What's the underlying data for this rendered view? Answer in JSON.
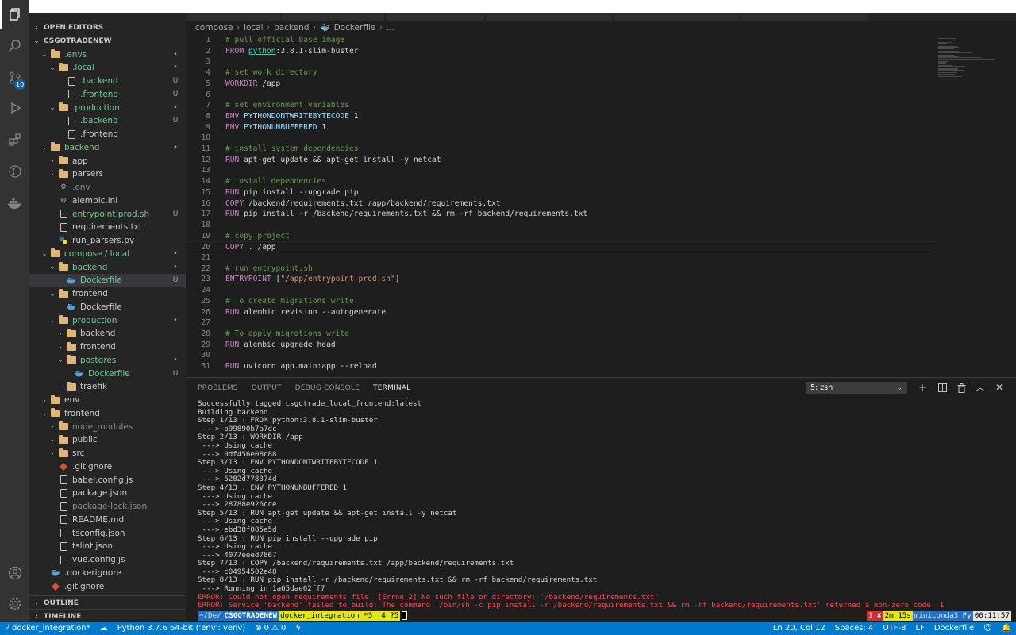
{
  "activity": {
    "scm_badge": "10"
  },
  "sidebar": {
    "open_editors": "OPEN EDITORS",
    "root": "CSGOTRADENEW",
    "tree": [
      {
        "label": ".envs",
        "depth": 1,
        "type": "folder",
        "open": true,
        "color": "green",
        "mark": "•"
      },
      {
        "label": ".local",
        "depth": 2,
        "type": "folder",
        "open": true,
        "color": "green",
        "mark": "•"
      },
      {
        "label": ".backend",
        "depth": 3,
        "type": "file",
        "color": "green",
        "mark": "U"
      },
      {
        "label": ".frontend",
        "depth": 3,
        "type": "file",
        "color": "green",
        "mark": "U"
      },
      {
        "label": ".production",
        "depth": 2,
        "type": "folder",
        "open": true,
        "color": "green",
        "mark": "•"
      },
      {
        "label": ".backend",
        "depth": 3,
        "type": "file",
        "color": "green",
        "mark": "U"
      },
      {
        "label": ".frontend",
        "depth": 3,
        "type": "file",
        "color": "normal",
        "mark": ""
      },
      {
        "label": "backend",
        "depth": 1,
        "type": "folder",
        "open": true,
        "color": "green",
        "mark": "•"
      },
      {
        "label": "app",
        "depth": 2,
        "type": "folder",
        "open": false,
        "color": "normal",
        "mark": ""
      },
      {
        "label": "parsers",
        "depth": 2,
        "type": "folder",
        "open": false,
        "color": "normal",
        "mark": ""
      },
      {
        "label": ".env",
        "depth": 2,
        "type": "gear",
        "color": "dim",
        "mark": ""
      },
      {
        "label": "alembic.ini",
        "depth": 2,
        "type": "gear",
        "color": "normal",
        "mark": ""
      },
      {
        "label": "entrypoint.prod.sh",
        "depth": 2,
        "type": "file",
        "color": "green",
        "mark": "U"
      },
      {
        "label": "requirements.txt",
        "depth": 2,
        "type": "file",
        "color": "normal",
        "mark": ""
      },
      {
        "label": "run_parsers.py",
        "depth": 2,
        "type": "python",
        "color": "normal",
        "mark": ""
      },
      {
        "label": "compose / local",
        "depth": 1,
        "type": "folder",
        "open": true,
        "color": "green",
        "mark": "•"
      },
      {
        "label": "backend",
        "depth": 2,
        "type": "folder",
        "open": true,
        "color": "green",
        "mark": "•"
      },
      {
        "label": "Dockerfile",
        "depth": 3,
        "type": "docker",
        "color": "green",
        "mark": "U",
        "selected": true
      },
      {
        "label": "frontend",
        "depth": 2,
        "type": "folder",
        "open": true,
        "color": "normal",
        "mark": ""
      },
      {
        "label": "Dockerfile",
        "depth": 3,
        "type": "docker",
        "color": "normal",
        "mark": ""
      },
      {
        "label": "production",
        "depth": 2,
        "type": "folder",
        "open": true,
        "color": "green",
        "mark": "•"
      },
      {
        "label": "backend",
        "depth": 3,
        "type": "folder",
        "open": false,
        "color": "normal",
        "mark": ""
      },
      {
        "label": "frontend",
        "depth": 3,
        "type": "folder",
        "open": false,
        "color": "normal",
        "mark": ""
      },
      {
        "label": "postgres",
        "depth": 3,
        "type": "folder",
        "open": true,
        "color": "green",
        "mark": "•"
      },
      {
        "label": "Dockerfile",
        "depth": 4,
        "type": "docker",
        "color": "green",
        "mark": "U"
      },
      {
        "label": "traefik",
        "depth": 3,
        "type": "folder",
        "open": false,
        "color": "normal",
        "mark": ""
      },
      {
        "label": "env",
        "depth": 1,
        "type": "folder",
        "open": false,
        "color": "normal",
        "mark": ""
      },
      {
        "label": "frontend",
        "depth": 1,
        "type": "folder",
        "open": true,
        "color": "normal",
        "mark": ""
      },
      {
        "label": "node_modules",
        "depth": 2,
        "type": "folder",
        "open": false,
        "color": "dim",
        "mark": ""
      },
      {
        "label": "public",
        "depth": 2,
        "type": "folder",
        "open": false,
        "color": "normal",
        "mark": ""
      },
      {
        "label": "src",
        "depth": 2,
        "type": "folder",
        "open": false,
        "color": "normal",
        "mark": ""
      },
      {
        "label": ".gitignore",
        "depth": 2,
        "type": "git",
        "color": "normal",
        "mark": ""
      },
      {
        "label": "babel.config.js",
        "depth": 2,
        "type": "file",
        "color": "normal",
        "mark": ""
      },
      {
        "label": "package.json",
        "depth": 2,
        "type": "file",
        "color": "normal",
        "mark": ""
      },
      {
        "label": "package-lock.json",
        "depth": 2,
        "type": "file",
        "color": "dim",
        "mark": ""
      },
      {
        "label": "README.md",
        "depth": 2,
        "type": "file",
        "color": "normal",
        "mark": ""
      },
      {
        "label": "tsconfig.json",
        "depth": 2,
        "type": "file",
        "color": "normal",
        "mark": ""
      },
      {
        "label": "tslint.json",
        "depth": 2,
        "type": "file",
        "color": "normal",
        "mark": ""
      },
      {
        "label": "vue.config.js",
        "depth": 2,
        "type": "file",
        "color": "normal",
        "mark": ""
      },
      {
        "label": ".dockerignore",
        "depth": 1,
        "type": "docker",
        "color": "normal",
        "mark": ""
      },
      {
        "label": ".gitignore",
        "depth": 1,
        "type": "git",
        "color": "normal",
        "mark": ""
      }
    ],
    "outline": "OUTLINE",
    "timeline": "TIMELINE"
  },
  "breadcrumb": [
    "compose",
    "local",
    "backend",
    "Dockerfile",
    "..."
  ],
  "editor": {
    "lines": [
      [
        [
          "c-comment",
          "# pull official base image"
        ]
      ],
      [
        [
          "c-kw",
          "FROM "
        ],
        [
          "c-base",
          "python"
        ],
        [
          "c-text",
          ":3.8.1-slim-buster"
        ]
      ],
      [],
      [
        [
          "c-comment",
          "# set work directory"
        ]
      ],
      [
        [
          "c-kw",
          "WORKDIR "
        ],
        [
          "c-text",
          "/app"
        ]
      ],
      [],
      [
        [
          "c-comment",
          "# set environment variables"
        ]
      ],
      [
        [
          "c-kw",
          "ENV "
        ],
        [
          "c-var",
          "PYTHONDONTWRITEBYTECODE"
        ],
        [
          "c-text",
          " 1"
        ]
      ],
      [
        [
          "c-kw",
          "ENV "
        ],
        [
          "c-var",
          "PYTHONUNBUFFERED"
        ],
        [
          "c-text",
          " 1"
        ]
      ],
      [],
      [
        [
          "c-comment",
          "# install system dependencies"
        ]
      ],
      [
        [
          "c-kw",
          "RUN "
        ],
        [
          "c-text",
          "apt-get update && apt-get install -y netcat"
        ]
      ],
      [],
      [
        [
          "c-comment",
          "# install dependencies"
        ]
      ],
      [
        [
          "c-kw",
          "RUN "
        ],
        [
          "c-text",
          "pip install --upgrade pip"
        ]
      ],
      [
        [
          "c-kw",
          "COPY "
        ],
        [
          "c-text",
          "/backend/requirements.txt /app/backend/requirements.txt"
        ]
      ],
      [
        [
          "c-kw",
          "RUN "
        ],
        [
          "c-text",
          "pip install -r /backend/requirements.txt && rm -rf backend/requirements.txt"
        ]
      ],
      [],
      [
        [
          "c-comment",
          "# copy project"
        ]
      ],
      [
        [
          "c-kw",
          "COPY "
        ],
        [
          "c-text",
          ". /app"
        ]
      ],
      [],
      [
        [
          "c-comment",
          "# run entrypoint.sh"
        ]
      ],
      [
        [
          "c-kw",
          "ENTRYPOINT "
        ],
        [
          "c-text",
          "["
        ],
        [
          "c-str",
          "\"/app/entrypoint.prod.sh\""
        ],
        [
          "c-text",
          "]"
        ]
      ],
      [],
      [
        [
          "c-comment",
          "# To create migrations write"
        ]
      ],
      [
        [
          "c-kw",
          "RUN "
        ],
        [
          "c-text",
          "alembic revision --autogenerate"
        ]
      ],
      [],
      [
        [
          "c-comment",
          "# To apply migrations write"
        ]
      ],
      [
        [
          "c-kw",
          "RUN "
        ],
        [
          "c-text",
          "alembic upgrade head"
        ]
      ],
      [],
      [
        [
          "c-kw",
          "RUN "
        ],
        [
          "c-text",
          "uvicorn app.main:app --reload"
        ]
      ]
    ]
  },
  "panel": {
    "tabs": [
      "PROBLEMS",
      "OUTPUT",
      "DEBUG CONSOLE",
      "TERMINAL"
    ],
    "active_tab": "TERMINAL",
    "terminal_selected": "5: zsh",
    "terminal_lines": [
      {
        "t": "Successfully tagged csgotrade_local_frontend:latest"
      },
      {
        "t": "Building backend"
      },
      {
        "t": "Step 1/13 : FROM python:3.8.1-slim-buster"
      },
      {
        "t": " ---> b99890b7a7dc"
      },
      {
        "t": "Step 2/13 : WORKDIR /app"
      },
      {
        "t": " ---> Using cache"
      },
      {
        "t": " ---> 0df456e08c88"
      },
      {
        "t": "Step 3/13 : ENV PYTHONDONTWRITEBYTECODE 1"
      },
      {
        "t": " ---> Using cache"
      },
      {
        "t": " ---> 6282d778374d"
      },
      {
        "t": "Step 4/13 : ENV PYTHONUNBUFFERED 1"
      },
      {
        "t": " ---> Using cache"
      },
      {
        "t": " ---> 28788e926cce"
      },
      {
        "t": "Step 5/13 : RUN apt-get update && apt-get install -y netcat"
      },
      {
        "t": " ---> Using cache"
      },
      {
        "t": " ---> ebd38f085e5d"
      },
      {
        "t": "Step 6/13 : RUN pip install --upgrade pip"
      },
      {
        "t": " ---> Using cache"
      },
      {
        "t": " ---> 4077eeed7867"
      },
      {
        "t": "Step 7/13 : COPY /backend/requirements.txt /app/backend/requirements.txt"
      },
      {
        "t": " ---> c04954502e48"
      },
      {
        "t": "Step 8/13 : RUN pip install -r /backend/requirements.txt && rm -rf backend/requirements.txt"
      },
      {
        "t": " ---> Running in 1a65dae62ff7"
      },
      {
        "t": "ERROR: Could not open requirements file: [Errno 2] No such file or directory: '/backend/requirements.txt'",
        "err": true
      },
      {
        "t": "ERROR: Service 'backend' failed to build: The command '/bin/sh -c pip install -r /backend/requirements.txt && rm -rf backend/requirements.txt' returned a non-zero code: 1",
        "err": true
      }
    ],
    "prompt": {
      "path": "~/De/",
      "dir": "CSGOTRADENEW",
      "git": "docker_integration *3 !4 ?5",
      "err": "1 ✘",
      "duration": "2m 15s",
      "env": "miniconda3 Py",
      "clock": "00:11:57"
    }
  },
  "statusbar": {
    "branch": "docker_integration*",
    "python": "Python 3.7.6 64-bit ('env': venv)",
    "errors": "0",
    "warnings": "0",
    "position": "Ln 20, Col 12",
    "spaces": "Spaces: 4",
    "encoding": "UTF-8",
    "eol": "LF",
    "language": "Dockerfile"
  }
}
